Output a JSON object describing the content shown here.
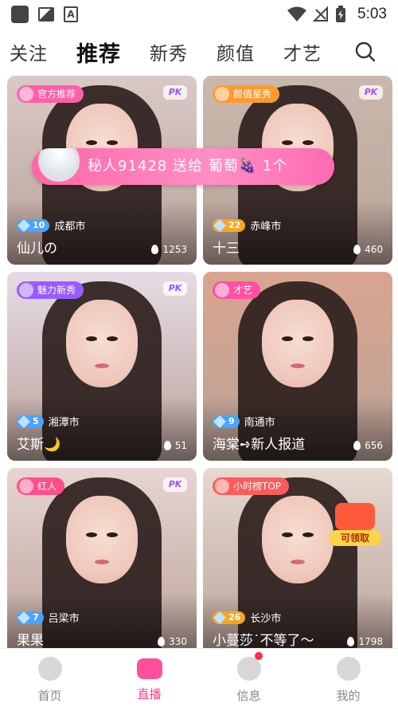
{
  "status_bar": {
    "time": "5:03"
  },
  "nav": {
    "tabs": [
      "关注",
      "推荐",
      "新秀",
      "颜值",
      "才艺"
    ],
    "active_index": 1
  },
  "gift_banner": {
    "text": "秘人91428 送给 葡萄",
    "grape": "🍇",
    "count": "1个"
  },
  "cards": [
    {
      "tag": "官方推荐",
      "tag_color": "#ff5fa8",
      "pk": "PK",
      "level": "10",
      "city": "成都市",
      "name": "仙儿の",
      "heat": "1253",
      "bg": "#d9c9c6"
    },
    {
      "tag": "颜值星秀",
      "tag_color": "#ff9a2e",
      "pk": "PK",
      "level": "22",
      "city": "赤峰市",
      "name": "十三",
      "heat": "460",
      "bg": "#c9b8ad"
    },
    {
      "tag": "魅力新秀",
      "tag_color": "#9a5cff",
      "pk": "PK",
      "level": "5",
      "city": "湘潭市",
      "name": "艾斯🌙",
      "heat": "51",
      "bg": "#e6dbe5"
    },
    {
      "tag": "才艺",
      "tag_color": "#ff4fa3",
      "pk": "",
      "level": "9",
      "city": "南通市",
      "name": "海棠➺新人报道",
      "heat": "656",
      "bg": "#d9a48f"
    },
    {
      "tag": "红人",
      "tag_color": "#ff4f8b",
      "pk": "PK",
      "level": "7",
      "city": "吕梁市",
      "name": "果果",
      "heat": "330",
      "bg": "#e8d5d1"
    },
    {
      "tag": "小时榜TOP",
      "tag_color": "#ff5a5a",
      "pk": "",
      "level": "26",
      "city": "长沙市",
      "name": "小蔓莎˙不等了～",
      "heat": "1798",
      "bg": "#e5d9d0",
      "claim": "可领取"
    }
  ],
  "tab_bar": {
    "items": [
      "首页",
      "直播",
      "信息",
      "我的"
    ],
    "active_index": 1
  },
  "colors": {
    "accent": "#ff3d8b",
    "tab_inactive": "#888888"
  }
}
